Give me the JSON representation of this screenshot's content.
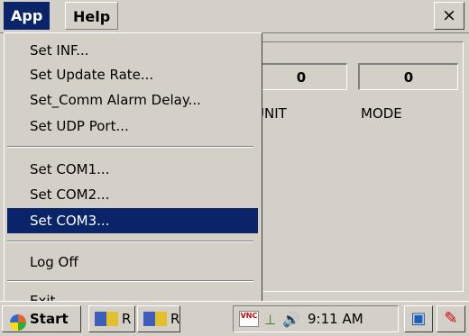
{
  "menubar": {
    "app_label": "App",
    "help_label": "Help",
    "close_glyph": "×"
  },
  "dropdown": {
    "items": [
      {
        "label": "Set INF...",
        "mnemonic": "S"
      },
      {
        "label": "Set Update Rate..."
      },
      {
        "label": "Set_Comm Alarm Delay..."
      },
      {
        "label": "Set UDP Port..."
      },
      {
        "label": "Set COM1..."
      },
      {
        "label": "Set COM2..."
      },
      {
        "label": "Set COM3...",
        "selected": true
      },
      {
        "label": "Log Off"
      },
      {
        "label": "Exit",
        "mnemonic": "x"
      }
    ]
  },
  "panel": {
    "unit_value": "0",
    "mode_value": "0",
    "unit_label": "UNIT",
    "mode_label": "MODE"
  },
  "taskbar": {
    "start_label": "Start",
    "task1_label": "R",
    "task2_label": "R",
    "vnc_text": "VNC",
    "clock": "9:11 AM"
  },
  "colors": {
    "face": "#d4d0c8",
    "highlight": "#0a246a",
    "shadow": "#808080"
  },
  "icons": [
    "start-flag-icon",
    "vnc-icon",
    "network-icon",
    "speaker-icon",
    "desktop-icon",
    "pen-icon"
  ]
}
